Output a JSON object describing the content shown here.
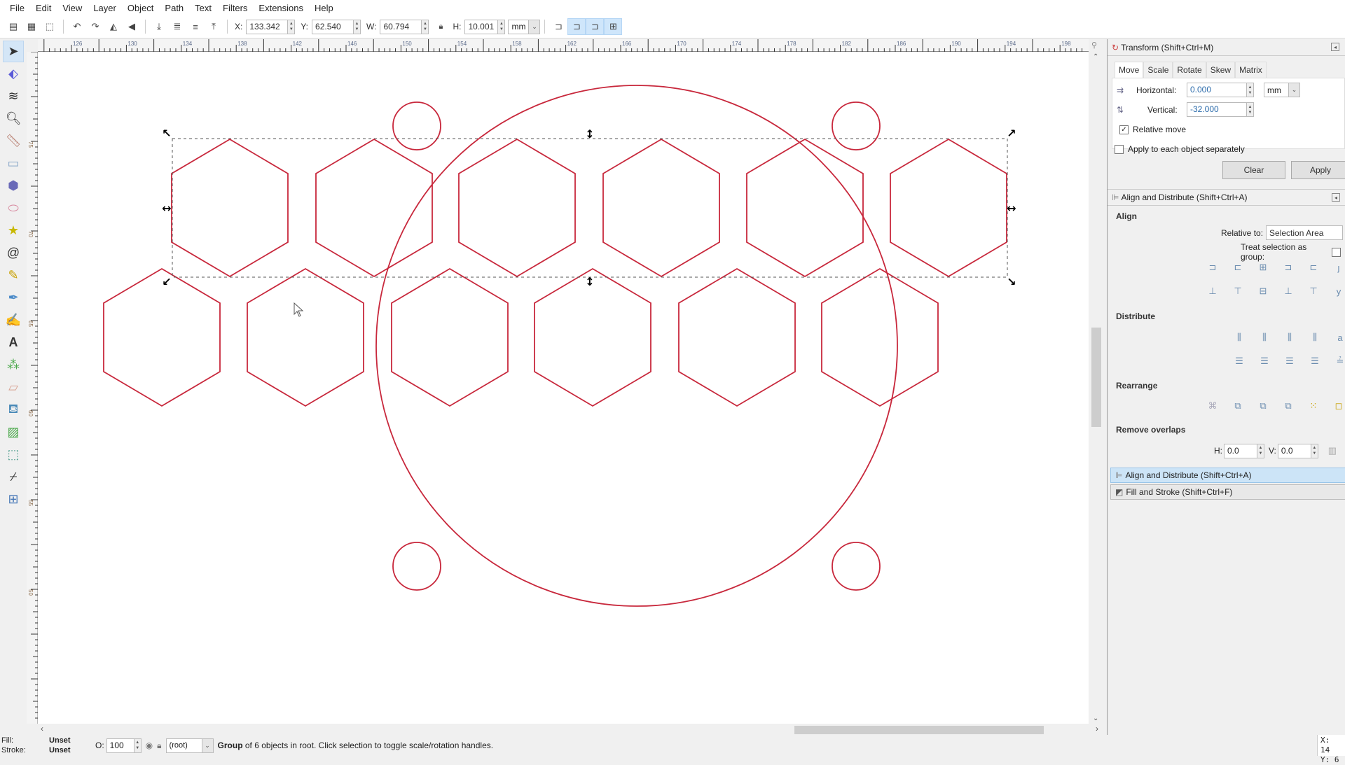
{
  "menu": [
    "File",
    "Edit",
    "View",
    "Layer",
    "Object",
    "Path",
    "Text",
    "Filters",
    "Extensions",
    "Help"
  ],
  "toolbar": {
    "icons": [
      "select-all-icon",
      "select-all-layers-icon",
      "deselect-icon",
      "rotate-ccw-icon",
      "rotate-cw-icon",
      "flip-horizontal-icon",
      "flip-vertical-icon",
      "lower-to-bottom-icon",
      "lower-icon",
      "raise-icon",
      "raise-to-top-icon"
    ],
    "x_label": "X:",
    "x_value": "133.342",
    "y_label": "Y:",
    "y_value": "62.540",
    "w_label": "W:",
    "w_value": "60.794",
    "h_label": "H:",
    "h_value": "10.001",
    "unit": "mm",
    "lock_icon": "lock-icon",
    "scale_toggles": [
      "scale-stroke-icon",
      "scale-radii-icon",
      "move-gradients-icon",
      "move-patterns-icon"
    ]
  },
  "tools": [
    "selector",
    "node",
    "tweak",
    "zoom",
    "measure",
    "rectangle",
    "3d-box",
    "ellipse",
    "star",
    "spiral",
    "pencil",
    "pen",
    "calligraphy",
    "text",
    "spray",
    "eraser",
    "paint-bucket",
    "gradient",
    "mesh",
    "dropper",
    "connector"
  ],
  "rulers": {
    "top_labels": [
      "126",
      "130",
      "134",
      "138",
      "142",
      "146",
      "150",
      "154",
      "158",
      "162",
      "166",
      "170",
      "174",
      "178",
      "182",
      "186",
      "190",
      "194",
      "198"
    ],
    "left_labels": [
      "75",
      "70",
      "65",
      "60",
      "55",
      "50"
    ]
  },
  "canvas": {
    "stroke_color": "#c8283c",
    "hex_rows": [
      {
        "label": "top-row",
        "selected": true,
        "count": 6
      },
      {
        "label": "bottom-row",
        "selected": false,
        "count": 6
      }
    ]
  },
  "transform_panel": {
    "title": "Transform (Shift+Ctrl+M)",
    "tabs": [
      "Move",
      "Scale",
      "Rotate",
      "Skew",
      "Matrix"
    ],
    "active_tab": "Move",
    "horizontal_label": "Horizontal:",
    "horizontal_value": "0.000",
    "vertical_label": "Vertical:",
    "vertical_value": "-32.000",
    "unit": "mm",
    "relative_move_label": "Relative move",
    "relative_move_checked": true,
    "apply_each_label": "Apply to each object separately",
    "apply_each_checked": false,
    "clear_label": "Clear",
    "apply_label": "Apply"
  },
  "align_panel": {
    "title": "Align and Distribute (Shift+Ctrl+A)",
    "align_header": "Align",
    "relative_to_label": "Relative to:",
    "relative_to_value": "Selection Area",
    "treat_group_label": "Treat selection as group:",
    "distribute_header": "Distribute",
    "rearrange_header": "Rearrange",
    "remove_overlaps_header": "Remove overlaps",
    "h_label": "H:",
    "h_value": "0.0",
    "v_label": "V:",
    "v_value": "0.0"
  },
  "docked": [
    {
      "label": "Align and Distribute (Shift+Ctrl+A)",
      "active": true
    },
    {
      "label": "Fill and Stroke (Shift+Ctrl+F)",
      "active": false
    }
  ],
  "status": {
    "fill_label": "Fill:",
    "fill_value": "Unset",
    "stroke_label": "Stroke:",
    "stroke_value": "Unset",
    "opacity_label": "O:",
    "opacity_value": "100",
    "layer": "(root)",
    "message_bold": "Group",
    "message_rest": " of 6 objects in root. Click selection to toggle scale/rotation handles.",
    "cursor_x_label": "X:",
    "cursor_x_value": "14",
    "cursor_y_label": "Y:",
    "cursor_y_value": "6"
  }
}
